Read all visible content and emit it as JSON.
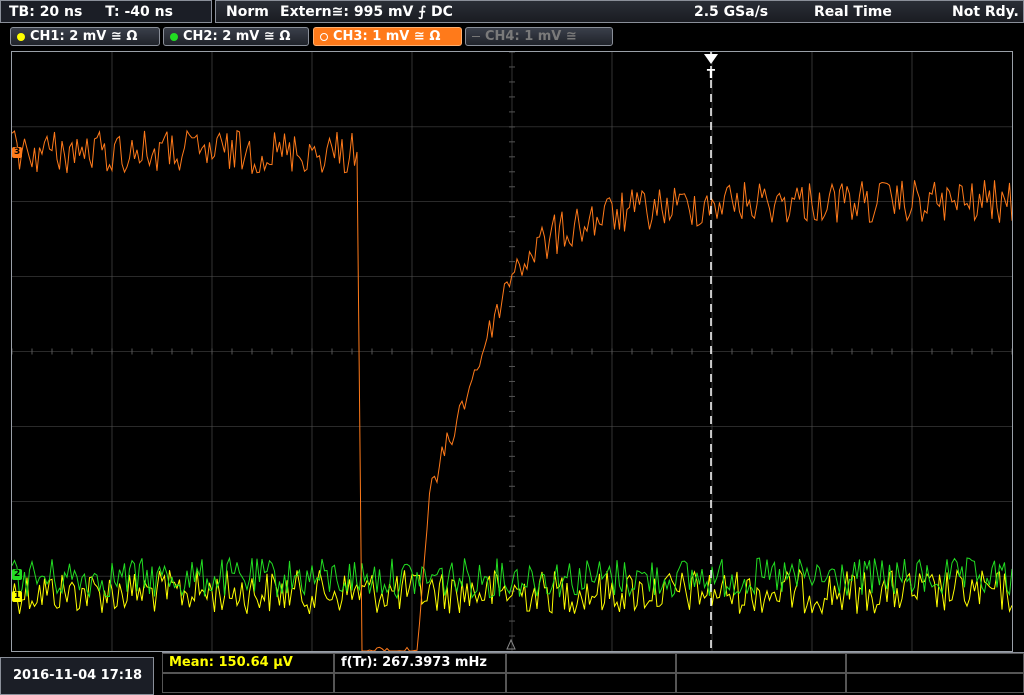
{
  "topbar": {
    "timebase": "TB: 20 ns",
    "trigger_time": "T: -40 ns",
    "mode": "Norm",
    "source": "Extern≅: 995 mV ⨍ DC",
    "sample_rate": "2.5 GSa/s",
    "acq": "Real Time",
    "status": "Not Rdy."
  },
  "channels": [
    {
      "label": "CH1: 2 mV ≅ Ω",
      "color": "#ffff00"
    },
    {
      "label": "CH2: 2 mV ≅ Ω",
      "color": "#22dd22"
    },
    {
      "label": "CH3: 1 mV ≅ Ω",
      "color": "#ff7a1a"
    },
    {
      "label": "CH4: 1 mV ≅",
      "color": "#777777"
    }
  ],
  "markers": {
    "ch3": "3",
    "ch2": "2",
    "ch1": "1",
    "trigger": "T"
  },
  "measurements": {
    "date": "2016-11-04 17:18",
    "mean": "Mean: 150.64 μV",
    "freq": "f(Tr): 267.3973 mHz"
  },
  "colors": {
    "ch1": "#ffff00",
    "ch2": "#22dd22",
    "ch3": "#ff7a1a",
    "grid": "#555555"
  }
}
